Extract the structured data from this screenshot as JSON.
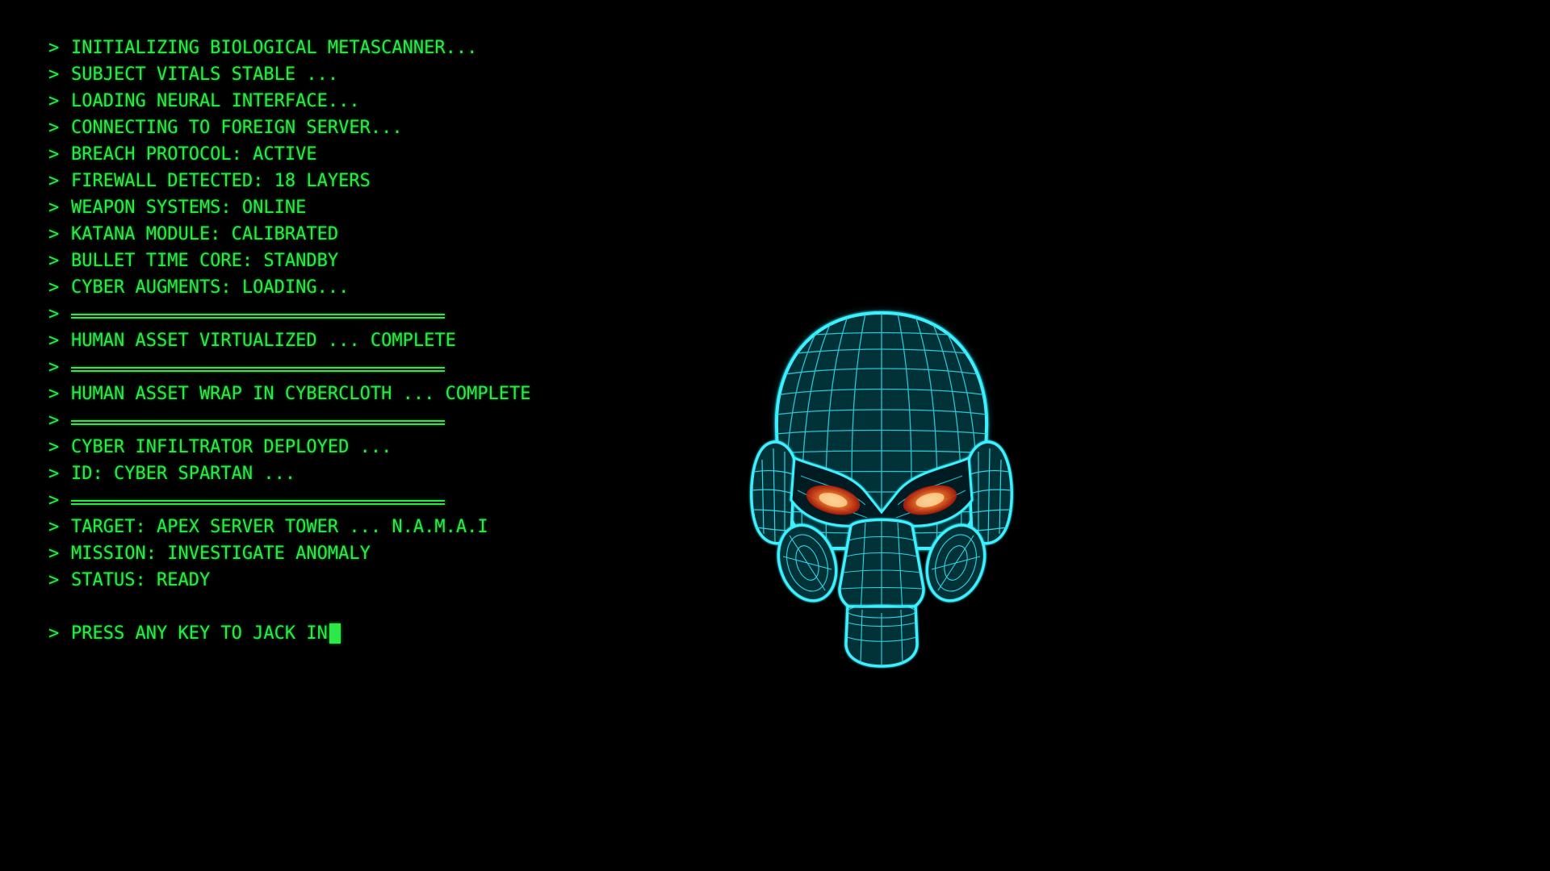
{
  "console": {
    "prompt": ">",
    "lines": [
      "INITIALIZING BIOLOGICAL METASCANNER...",
      "SUBJECT VITALS STABLE ...",
      "LOADING NEURAL INTERFACE...",
      "CONNECTING TO FOREIGN SERVER...",
      "BREACH PROTOCOL: ACTIVE",
      "FIREWALL DETECTED: 18 LAYERS",
      "WEAPON SYSTEMS: ONLINE",
      "KATANA MODULE: CALIBRATED",
      "BULLET TIME CORE: STANDBY",
      "CYBER AUGMENTS: LOADING...",
      "HUMAN ASSET VIRTUALIZED ... COMPLETE",
      "HUMAN ASSET WRAP IN CYBERCLOTH ... COMPLETE",
      "CYBER INFILTRATOR DEPLOYED ...",
      "ID: CYBER SPARTAN ...",
      "TARGET: APEX SERVER TOWER ... N.A.M.A.I",
      "MISSION: INVESTIGATE ANOMALY",
      "STATUS: READY",
      "PRESS ANY KEY TO JACK IN"
    ]
  },
  "colors": {
    "terminal_green": "#2ee84a",
    "wireframe_cyan": "#31e6f2",
    "eye_glow": "#ff6a2a",
    "background": "#000000"
  },
  "graphics": {
    "helmet": "wireframe-cyber-helmet-icon"
  }
}
